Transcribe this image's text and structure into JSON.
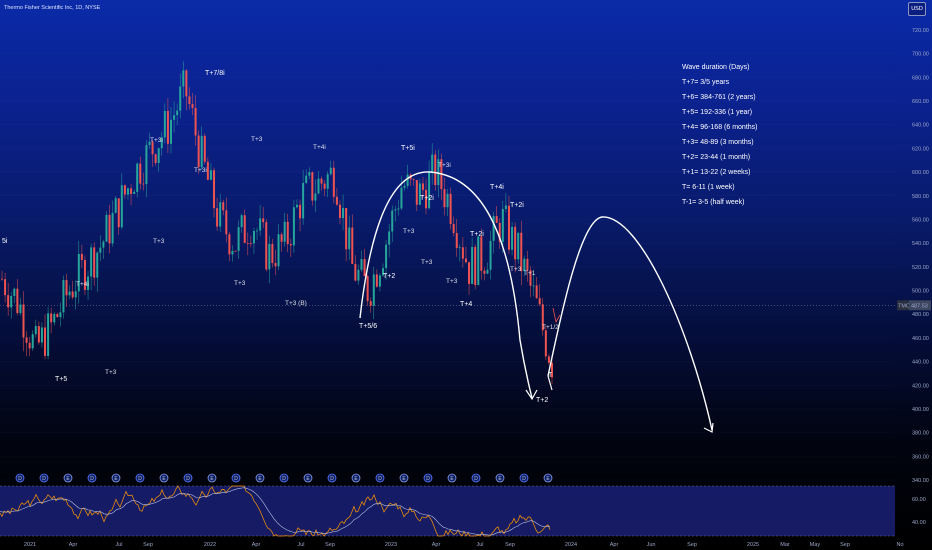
{
  "header": {
    "title": "Thermo Fisher Scientific Inc, 1D, NYSE",
    "currency": "USD"
  },
  "colors": {
    "bull": "#26a69a",
    "bear": "#ef5350",
    "path": "#ffffff",
    "rsi": "#ff9800",
    "rsi_ma": "#b7c3e6",
    "label_teal": "#26a69a",
    "label_red": "#ef5350",
    "label_blue": "#2962ff"
  },
  "price_axis": {
    "ticks": [
      "720.00",
      "700.00",
      "680.00",
      "660.00",
      "640.00",
      "620.00",
      "600.00",
      "580.00",
      "560.00",
      "540.00",
      "520.00",
      "500.00",
      "480.00",
      "460.00",
      "440.00",
      "420.00",
      "400.00",
      "380.00",
      "360.00",
      "340.00"
    ],
    "current": "487.53",
    "symbol": "TMO"
  },
  "rsi_axis": {
    "ticks": [
      "60.00",
      "40.00"
    ]
  },
  "time_axis": {
    "ticks": [
      "2021",
      "Apr",
      "Jul",
      "Sep",
      "2022",
      "Apr",
      "Jul",
      "Sep",
      "2023",
      "Apr",
      "Jul",
      "Sep",
      "2024",
      "Apr",
      "Jun",
      "Sep",
      "2025",
      "Mar",
      "May",
      "Sep",
      "No"
    ]
  },
  "legend": {
    "heading": "Wave duration (Days)",
    "lines": [
      "T+7= 3/5 years",
      "T+6= 384-761 (2 years)",
      "T+5= 192-336 (1 year)",
      "T+4= 96-168 (6 months)",
      "T+3= 48-89 (3 months)",
      "T+2= 23-44 (1 month)",
      "T+1= 13-22 (2 weeks)",
      "T= 6-11 (1 week)",
      "T-1= 3-5 (half week)"
    ]
  },
  "wave_labels": [
    {
      "text": "T+7/8i",
      "color": "white"
    },
    {
      "text": "T+5",
      "color": "white"
    },
    {
      "text": "T+5i",
      "color": "white"
    },
    {
      "text": "T+5/6",
      "color": "white"
    },
    {
      "text": "T+2",
      "color": "white"
    },
    {
      "text": "T",
      "color": "white"
    },
    {
      "text": "5i",
      "color": "white"
    },
    {
      "text": "T+4i",
      "color": "teal"
    },
    {
      "text": "T+3",
      "color": "teal"
    },
    {
      "text": "T+3i",
      "color": "teal"
    },
    {
      "text": "T+3",
      "color": "teal"
    },
    {
      "text": "T+3i",
      "color": "teal"
    },
    {
      "text": "T+3",
      "color": "teal"
    },
    {
      "text": "T+3",
      "color": "teal"
    },
    {
      "text": "T+4i",
      "color": "teal"
    },
    {
      "text": "T+3 (B)",
      "color": "red"
    },
    {
      "text": "T+3i",
      "color": "teal"
    },
    {
      "text": "T+2i",
      "color": "white"
    },
    {
      "text": "T+2",
      "color": "white"
    },
    {
      "text": "T+3",
      "color": "teal"
    },
    {
      "text": "T+3",
      "color": "teal"
    },
    {
      "text": "T+2i",
      "color": "white"
    },
    {
      "text": "T+4i",
      "color": "white"
    },
    {
      "text": "T+2i",
      "color": "white"
    },
    {
      "text": "T+3",
      "color": "blue"
    },
    {
      "text": "T+4",
      "color": "white"
    },
    {
      "text": "T+1",
      "color": "blue"
    },
    {
      "text": "T+3",
      "color": "blue"
    },
    {
      "text": "T+1/2",
      "color": "blue"
    }
  ],
  "events": [
    "D",
    "D",
    "E",
    "D",
    "E",
    "D",
    "E",
    "D",
    "E",
    "D",
    "E",
    "D",
    "E",
    "D",
    "E",
    "D",
    "E",
    "D",
    "E",
    "D",
    "E",
    "D",
    "E"
  ],
  "chart_data": {
    "type": "line",
    "title": "Thermo Fisher Scientific Inc, 1D, NYSE",
    "xlabel": "",
    "ylabel": "",
    "ylim": [
      340,
      730
    ],
    "series": [
      {
        "x": [
          "2021-01",
          "2021-02",
          "2021-03",
          "2021-04",
          "2021-05",
          "2021-06",
          "2021-07",
          "2021-08",
          "2021-09",
          "2021-10",
          "2021-11",
          "2021-12",
          "2022-01",
          "2022-02",
          "2022-03",
          "2022-04",
          "2022-05",
          "2022-06",
          "2022-07",
          "2022-08",
          "2022-09",
          "2022-10",
          "2022-11",
          "2022-12",
          "2023-01",
          "2023-02",
          "2023-03",
          "2023-04",
          "2023-05",
          "2023-06",
          "2023-07",
          "2023-08",
          "2023-09",
          "2023-10"
        ],
        "values": [
          510,
          490,
          450,
          470,
          500,
          520,
          540,
          570,
          600,
          620,
          640,
          670,
          610,
          560,
          540,
          560,
          530,
          540,
          580,
          590,
          600,
          520,
          500,
          540,
          590,
          580,
          600,
          570,
          520,
          530,
          560,
          530,
          490,
          440
        ]
      }
    ],
    "projection": [
      {
        "x": "2023-10",
        "y": 440
      },
      {
        "x": "2023-12",
        "y": 560
      },
      {
        "x": "2024-03",
        "y": 570
      },
      {
        "x": "2024-07",
        "y": 470
      },
      {
        "x": "2024-09",
        "y": 380
      }
    ]
  }
}
